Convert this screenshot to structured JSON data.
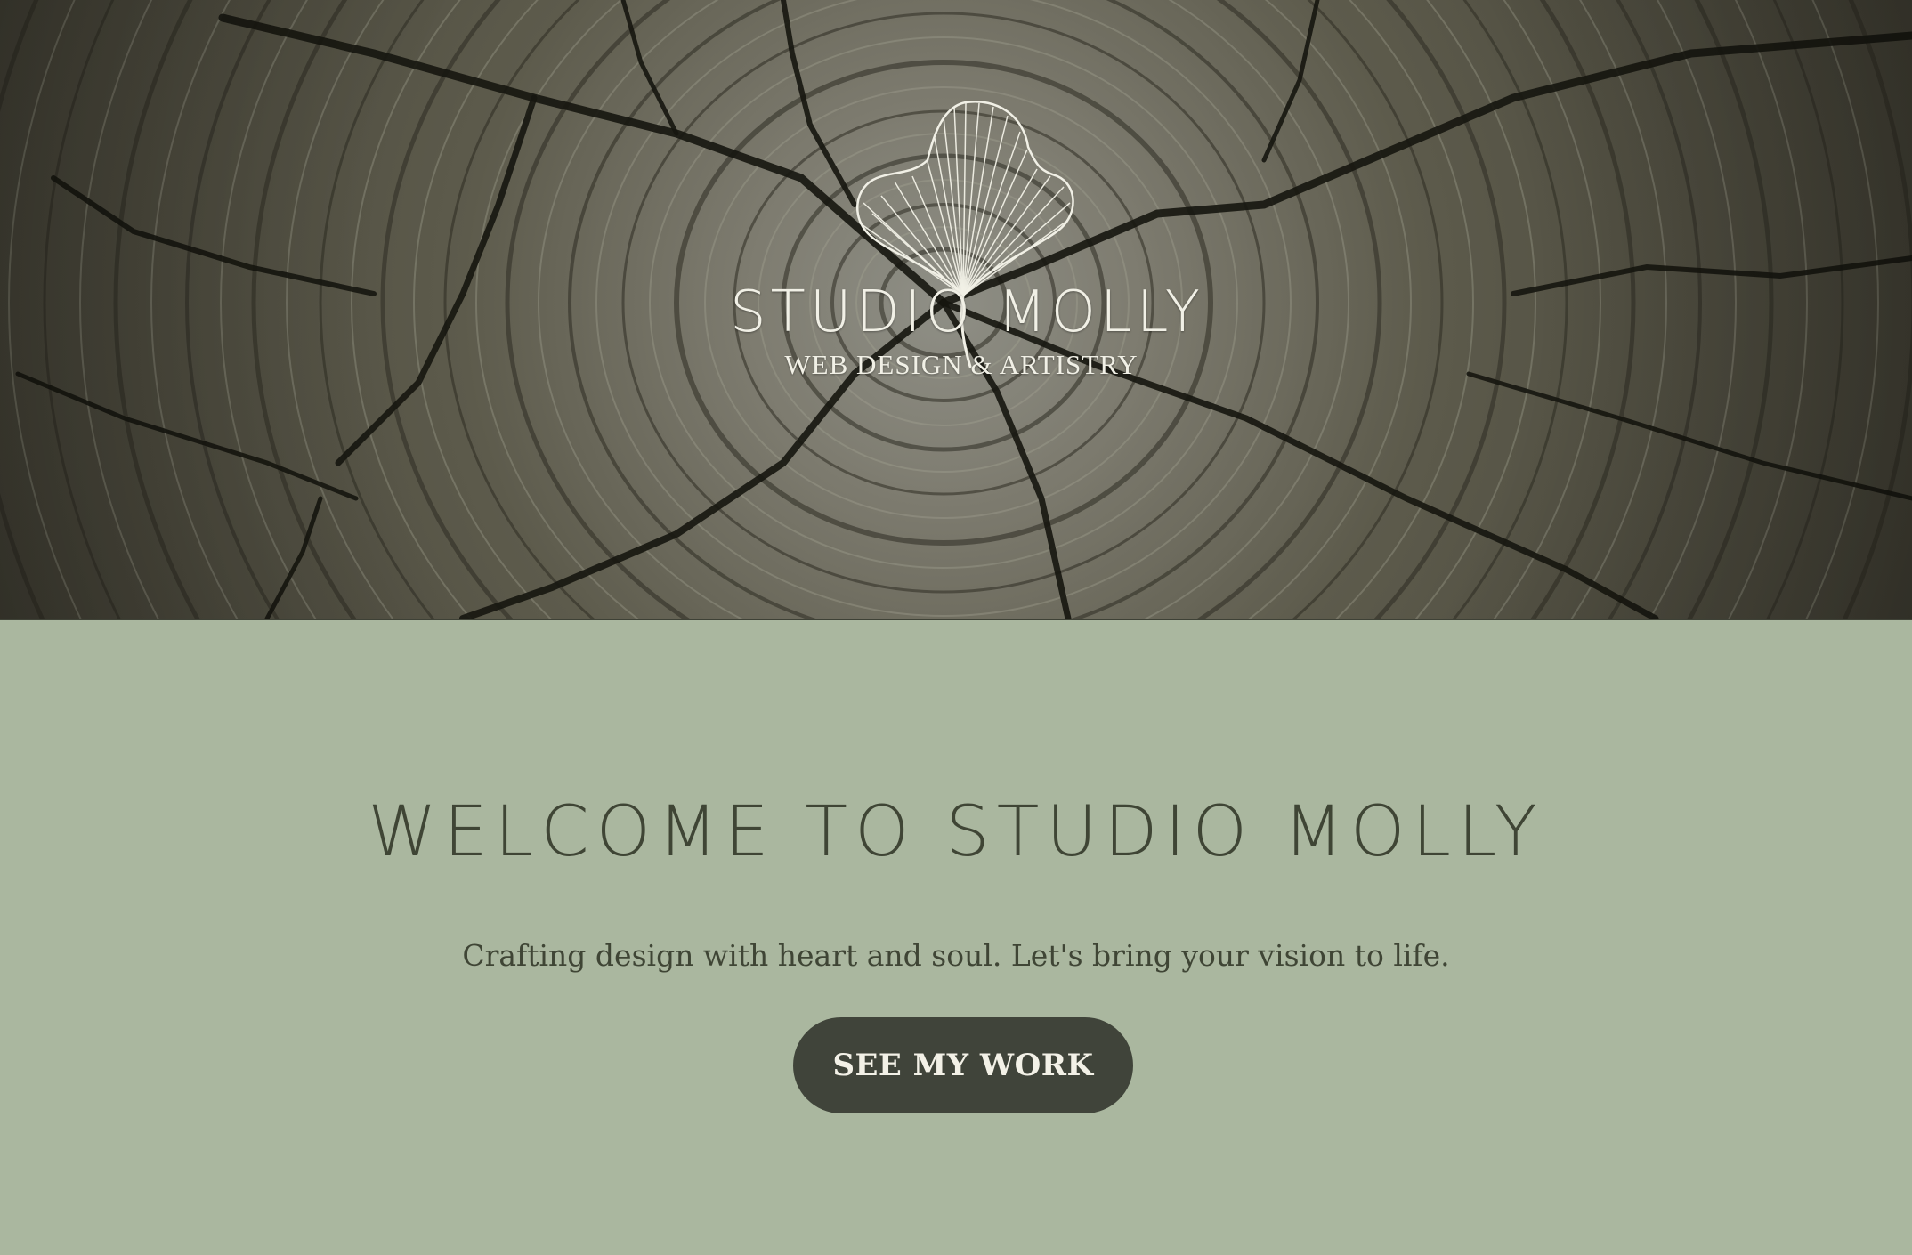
{
  "hero": {
    "background_image": "tree-rings-wood-texture",
    "logo": {
      "icon": "ginkgo-leaf-icon",
      "title": "STUDIO MOLLY",
      "subtitle": "WEB DESIGN & ARTISTRY"
    }
  },
  "welcome": {
    "heading": "WELCOME TO STUDIO MOLLY",
    "tagline": "Crafting design with heart and soul. Let's bring your vision to life.",
    "cta_label": "SEE MY WORK"
  },
  "colors": {
    "section_background": "#aab79f",
    "text_dark": "#3f4535",
    "button_background": "#40443a",
    "logo_cream": "#f1f0e6"
  }
}
